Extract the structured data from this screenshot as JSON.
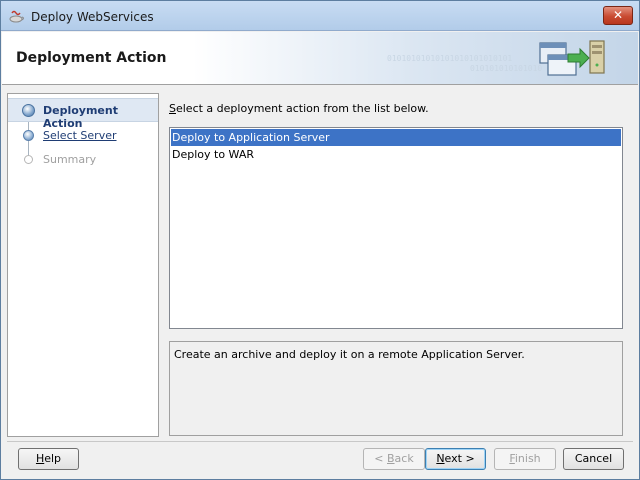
{
  "window": {
    "title": "Deploy WebServices",
    "close_label": "✕"
  },
  "header": {
    "title": "Deployment Action",
    "binary_line1": "01010101010101010101010101",
    "binary_line2": "010101010101010"
  },
  "nav": {
    "steps": [
      {
        "label": "Deployment Action",
        "state": "active"
      },
      {
        "label": "Select Server",
        "state": "link"
      },
      {
        "label": "Summary",
        "state": "disabled"
      }
    ]
  },
  "main": {
    "instruction_mnemonic": "S",
    "instruction_rest": "elect a deployment action from the list below.",
    "actions": [
      {
        "label": "Deploy to Application Server",
        "selected": true
      },
      {
        "label": "Deploy to WAR",
        "selected": false
      }
    ],
    "description": "Create an archive and deploy it on a remote Application Server."
  },
  "buttons": {
    "help_mnemonic": "H",
    "help_rest": "elp",
    "back_prefix": "< ",
    "back_mnemonic": "B",
    "back_rest": "ack",
    "next_mnemonic": "N",
    "next_rest": "ext >",
    "finish_mnemonic": "F",
    "finish_rest": "inish",
    "cancel": "Cancel"
  },
  "colors": {
    "selection": "#3d73c6",
    "accent": "#1f3d74"
  }
}
